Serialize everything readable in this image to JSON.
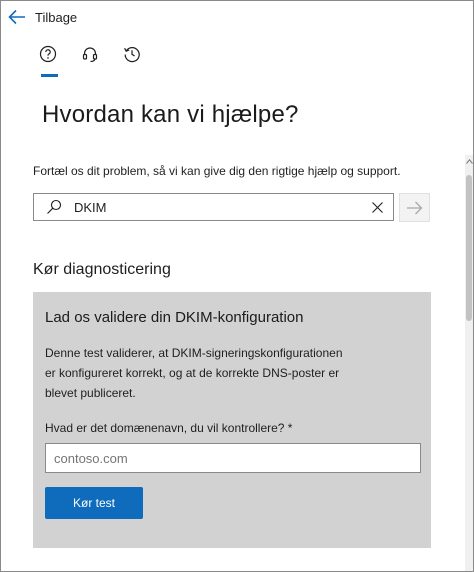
{
  "header": {
    "back_label": "Tilbage"
  },
  "tabs": [
    {
      "name": "help",
      "icon": "question-circle-icon",
      "active": true
    },
    {
      "name": "contact",
      "icon": "headset-icon",
      "active": false
    },
    {
      "name": "history",
      "icon": "history-clock-icon",
      "active": false
    }
  ],
  "main": {
    "title": "Hvordan kan vi hjælpe?",
    "intro": "Fortæl os dit problem, så vi kan give dig den rigtige hjælp og support.",
    "search": {
      "value": "DKIM",
      "icon": "search-icon",
      "clear_icon": "close-icon",
      "submit_icon": "arrow-right-icon"
    }
  },
  "diagnostics": {
    "heading": "Kør diagnosticering",
    "card": {
      "title": "Lad os validere din DKIM-konfiguration",
      "description": "Denne test validerer, at DKIM-signeringskonfigurationen er konfigureret korrekt, og at de korrekte DNS-poster er blevet publiceret.",
      "field_label": "Hvad er det domænenavn, du vil kontrollere? *",
      "field_placeholder": "contoso.com",
      "run_button": "Kør test"
    }
  },
  "colors": {
    "accent": "#0f6cbd",
    "card_background": "#d2d2d2",
    "text": "#1f1f1f"
  }
}
